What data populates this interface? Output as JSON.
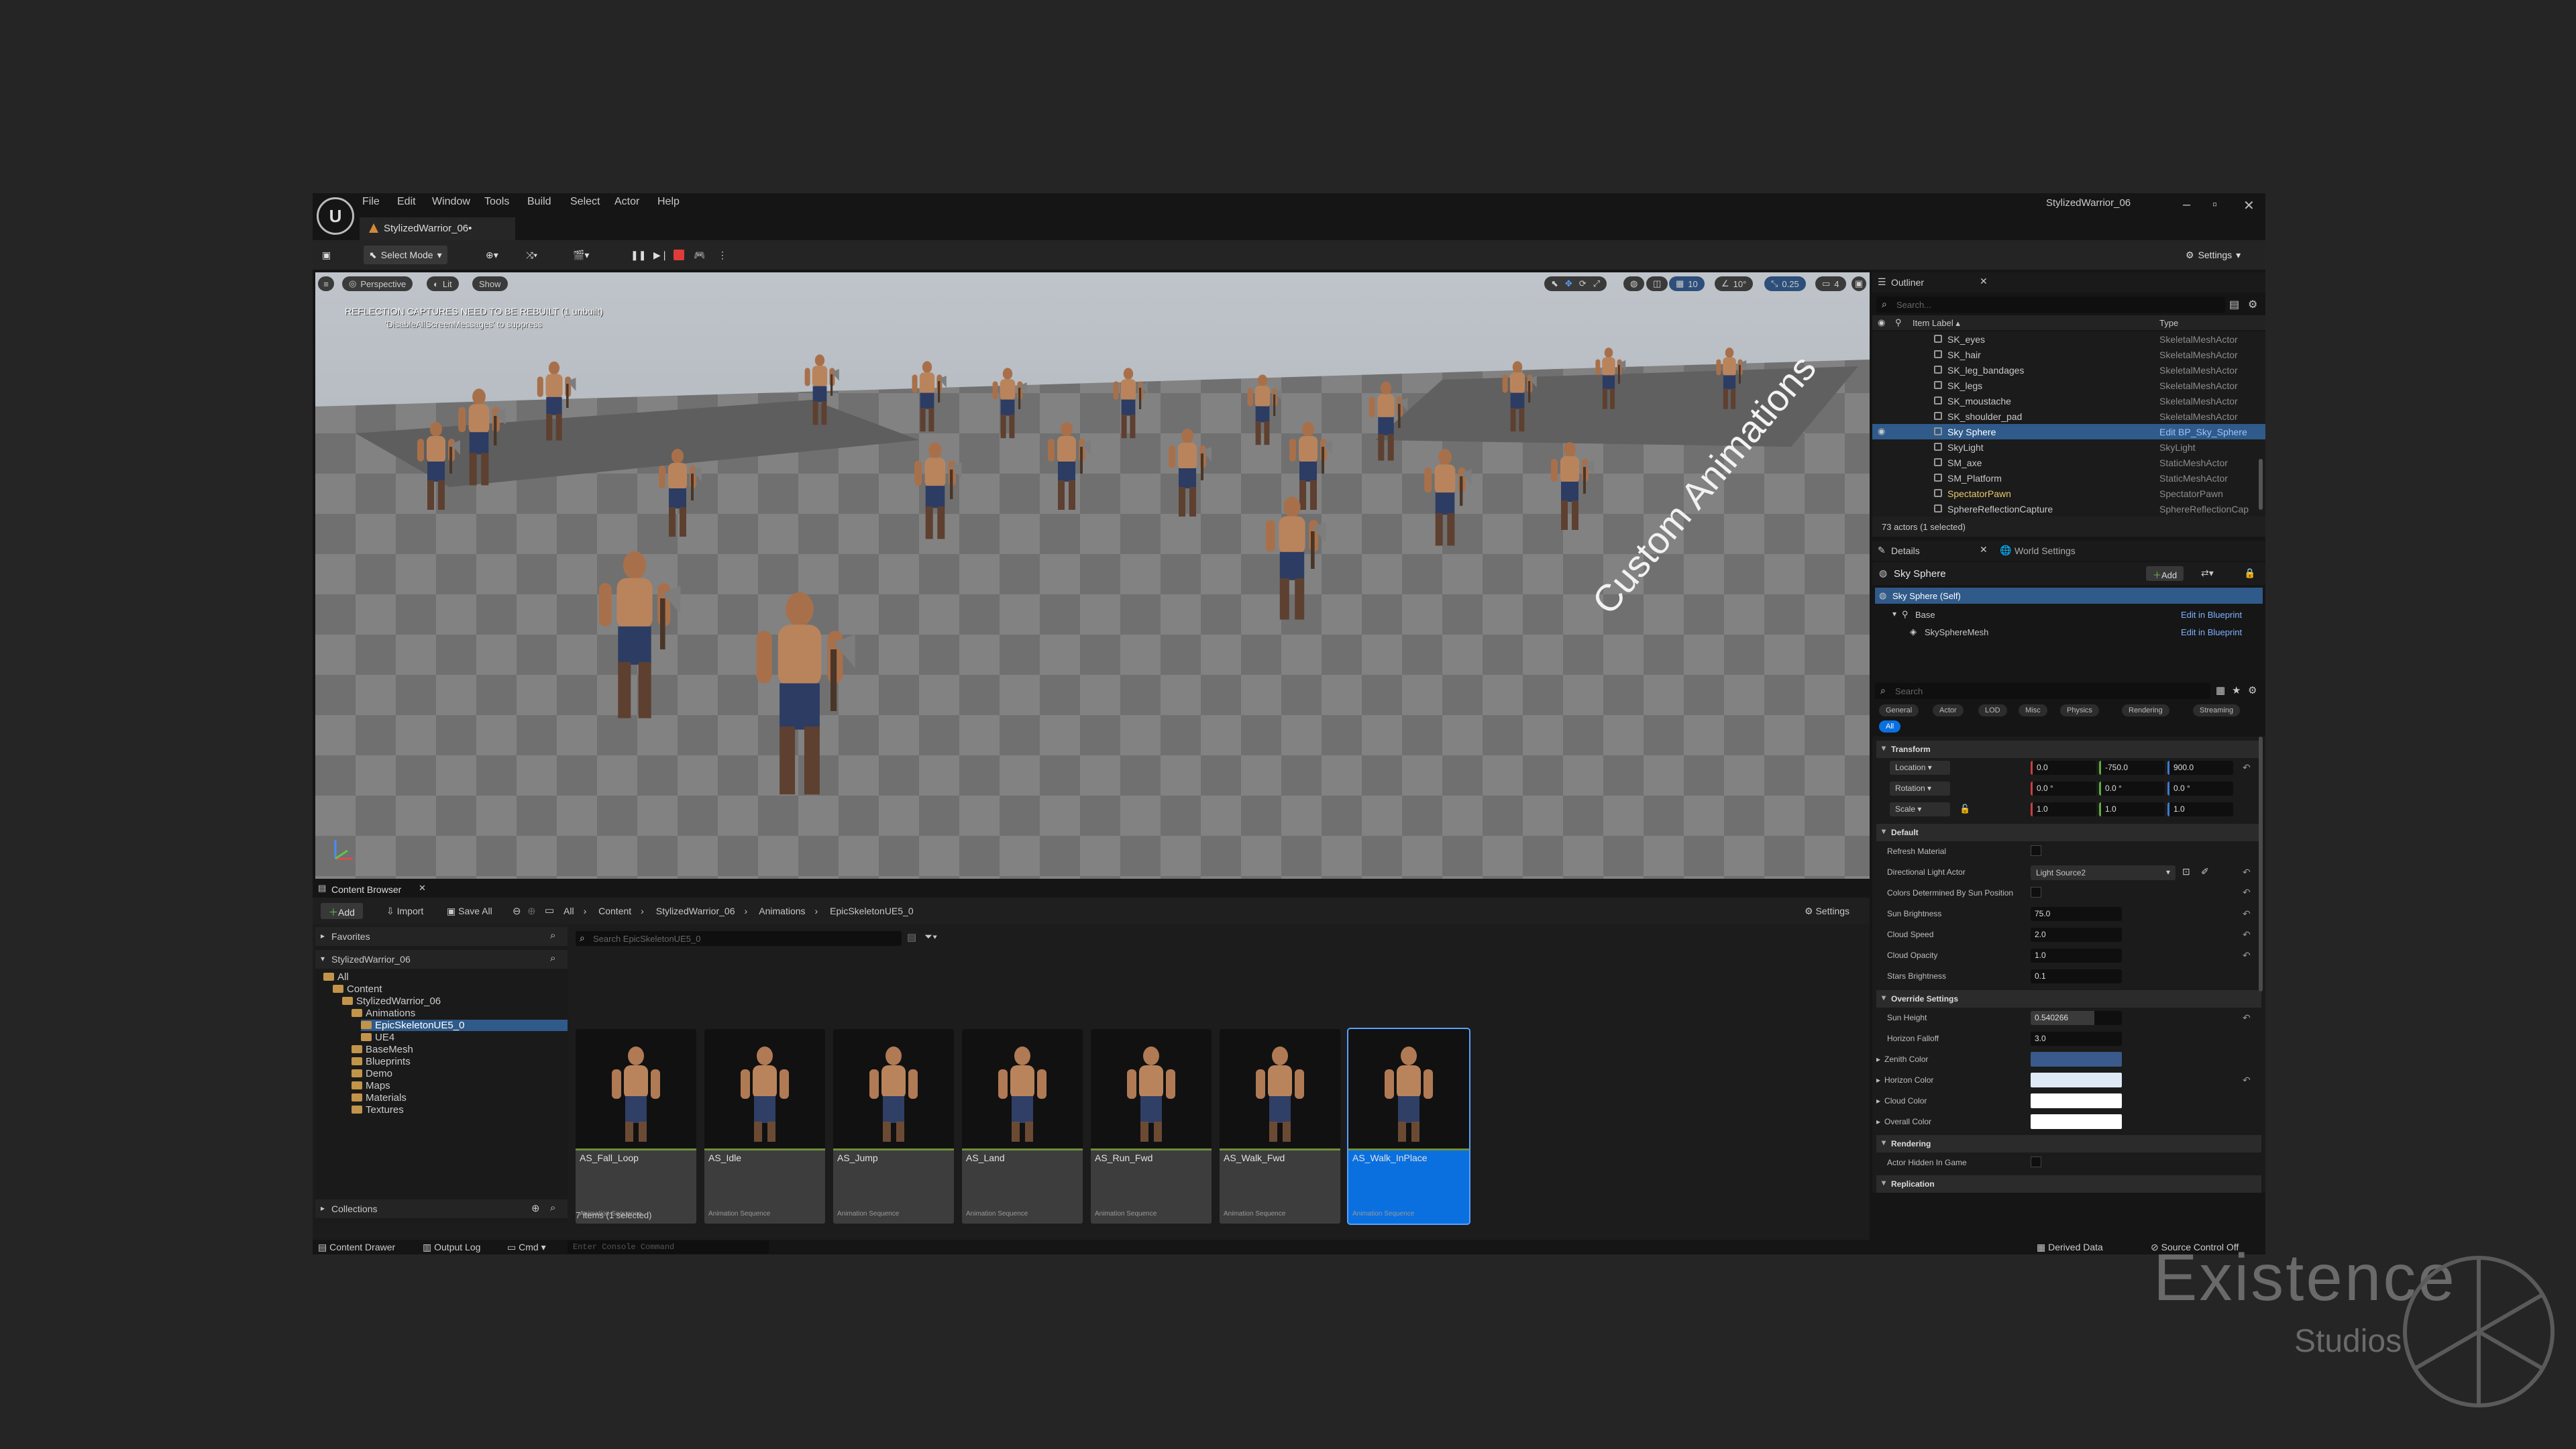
{
  "app": {
    "menus": [
      "File",
      "Edit",
      "Window",
      "Tools",
      "Build",
      "Select",
      "Actor",
      "Help"
    ],
    "project_name": "StylizedWarrior_06",
    "doc_tab": "StylizedWarrior_06•",
    "window_controls": [
      "–",
      "▫",
      "✕"
    ]
  },
  "toolbar": {
    "select_mode": "Select Mode",
    "settings": "Settings"
  },
  "viewport": {
    "perspective": "Perspective",
    "lit": "Lit",
    "show": "Show",
    "warning": "REFLECTION CAPTURES NEED TO BE REBUILT (1 unbuilt)",
    "warning_sub": "'DisableAllScreenMessages' to suppress",
    "floor_text": "Custom Animations",
    "grid_snap": "10",
    "rot_snap": "10°",
    "scale_snap": "0.25",
    "camera_speed": "4"
  },
  "outliner": {
    "tab": "Outliner",
    "search_placeholder": "Search...",
    "col_label": "Item Label ▴",
    "col_type": "Type",
    "rows": [
      {
        "label": "SK_eyes",
        "type": "SkeletalMeshActor"
      },
      {
        "label": "SK_hair",
        "type": "SkeletalMeshActor"
      },
      {
        "label": "SK_leg_bandages",
        "type": "SkeletalMeshActor"
      },
      {
        "label": "SK_legs",
        "type": "SkeletalMeshActor"
      },
      {
        "label": "SK_moustache",
        "type": "SkeletalMeshActor"
      },
      {
        "label": "SK_shoulder_pad",
        "type": "SkeletalMeshActor"
      },
      {
        "label": "Sky Sphere",
        "type": "Edit BP_Sky_Sphere"
      },
      {
        "label": "SkyLight",
        "type": "SkyLight"
      },
      {
        "label": "SM_axe",
        "type": "StaticMeshActor"
      },
      {
        "label": "SM_Platform",
        "type": "StaticMeshActor"
      },
      {
        "label": "SpectatorPawn",
        "type": "SpectatorPawn"
      },
      {
        "label": "SphereReflectionCapture",
        "type": "SphereReflectionCap"
      }
    ],
    "count": "73 actors (1 selected)"
  },
  "details": {
    "tab": "Details",
    "world_tab": "World Settings",
    "actor_name": "Sky Sphere",
    "add": "Add",
    "components": [
      {
        "label": "Sky Sphere (Self)",
        "action": ""
      },
      {
        "label": "Base",
        "action": "Edit in Blueprint"
      },
      {
        "label": "SkySphereMesh",
        "action": "Edit in Blueprint"
      }
    ],
    "search_placeholder": "Search",
    "categories": [
      "General",
      "Actor",
      "LOD",
      "Misc",
      "Physics",
      "Rendering",
      "Streaming"
    ],
    "all_chip": "All",
    "transform": {
      "title": "Transform",
      "location_label": "Location",
      "rotation_label": "Rotation",
      "scale_label": "Scale",
      "location": [
        "0.0",
        "-750.0",
        "900.0"
      ],
      "rotation": [
        "0.0 °",
        "0.0 °",
        "0.0 °"
      ],
      "scale": [
        "1.0",
        "1.0",
        "1.0"
      ]
    },
    "default_section": "Default",
    "refresh_material": "Refresh Material",
    "dir_light_label": "Directional Light Actor",
    "dir_light_value": "Light Source2",
    "colors_by_sun": "Colors Determined By Sun Position",
    "sun_brightness_label": "Sun Brightness",
    "sun_brightness": "75.0",
    "cloud_speed_label": "Cloud Speed",
    "cloud_speed": "2.0",
    "cloud_opacity_label": "Cloud Opacity",
    "cloud_opacity": "1.0",
    "stars_brightness_label": "Stars Brightness",
    "stars_brightness": "0.1",
    "override_section": "Override Settings",
    "sun_height_label": "Sun Height",
    "sun_height": "0.540266",
    "horizon_falloff_label": "Horizon Falloff",
    "horizon_falloff": "3.0",
    "zenith_color_label": "Zenith Color",
    "zenith_color": "#3a5a8c",
    "horizon_color_label": "Horizon Color",
    "horizon_color": "#dfe9f5",
    "cloud_color_label": "Cloud Color",
    "cloud_color": "#ffffff",
    "overall_color_label": "Overall Color",
    "overall_color": "#ffffff",
    "rendering_section": "Rendering",
    "hidden_in_game": "Actor Hidden In Game",
    "replication_section": "Replication"
  },
  "content_browser": {
    "tab": "Content Browser",
    "add": "Add",
    "import": "Import",
    "save_all": "Save All",
    "breadcrumb": [
      "All",
      "Content",
      "StylizedWarrior_06",
      "Animations",
      "EpicSkeletonUE5_0"
    ],
    "settings": "Settings",
    "favorites": "Favorites",
    "project": "StylizedWarrior_06",
    "search_placeholder": "Search EpicSkeletonUE5_0",
    "tree": [
      "All",
      "Content",
      "StylizedWarrior_06",
      "Animations",
      "EpicSkeletonUE5_0",
      "UE4",
      "BaseMesh",
      "Blueprints",
      "Demo",
      "Maps",
      "Materials",
      "Textures"
    ],
    "collections": "Collections",
    "assets": [
      {
        "name": "AS_Fall_Loop",
        "type": "Animation Sequence"
      },
      {
        "name": "AS_Idle",
        "type": "Animation Sequence"
      },
      {
        "name": "AS_Jump",
        "type": "Animation Sequence"
      },
      {
        "name": "AS_Land",
        "type": "Animation Sequence"
      },
      {
        "name": "AS_Run_Fwd",
        "type": "Animation Sequence"
      },
      {
        "name": "AS_Walk_Fwd",
        "type": "Animation Sequence"
      },
      {
        "name": "AS_Walk_InPlace",
        "type": "Animation Sequence"
      }
    ],
    "count": "7 items (1 selected)"
  },
  "statusbar": {
    "content_drawer": "Content Drawer",
    "output_log": "Output Log",
    "cmd": "Cmd",
    "console_placeholder": "Enter Console Command",
    "derived_data": "Derived Data",
    "source_control": "Source Control Off"
  },
  "watermark": {
    "title": "Existence",
    "sub": "Studios"
  },
  "colors": {
    "accent": "#0a70e0",
    "selection": "#2f5a8a",
    "record": "#e03b3b"
  }
}
